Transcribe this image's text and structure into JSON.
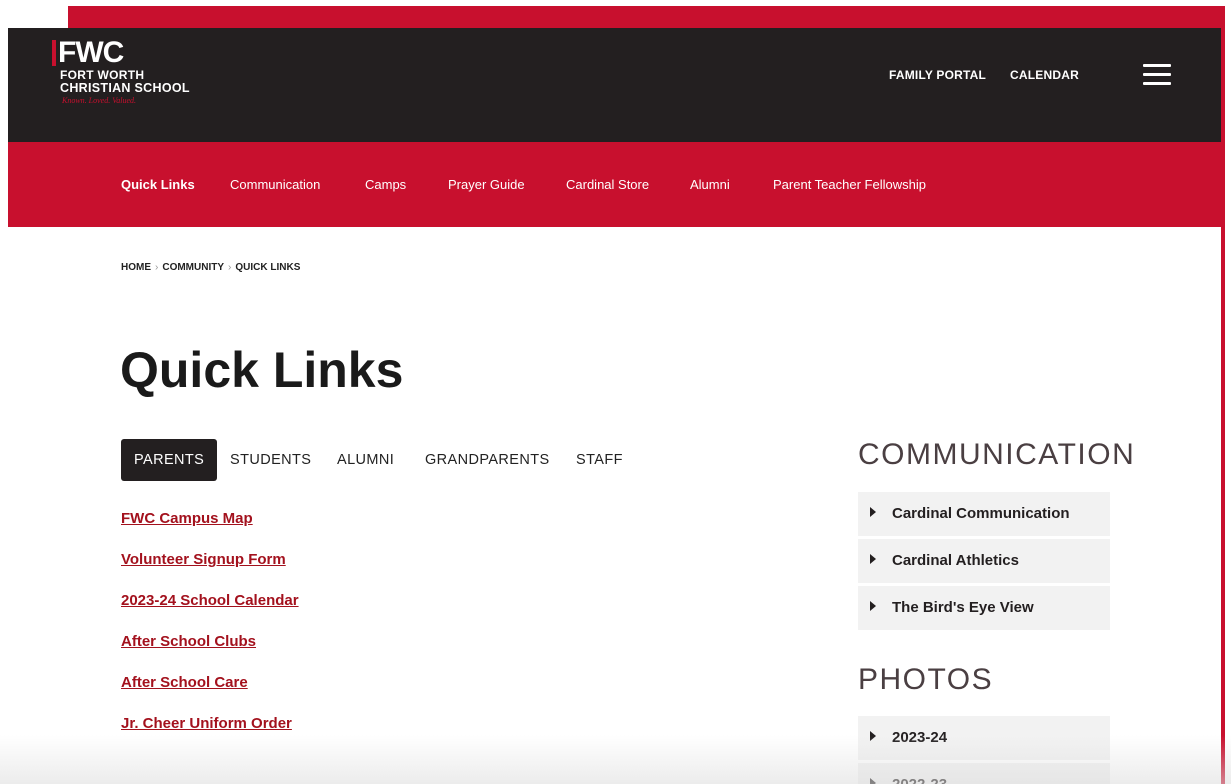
{
  "header": {
    "logo_mark": "FWC",
    "logo_line1": "FORT WORTH",
    "logo_line2": "CHRISTIAN SCHOOL",
    "logo_tagline": "Known. Loved. Valued.",
    "family_portal": "FAMILY PORTAL",
    "calendar": "CALENDAR",
    "menu_icon": "hamburger-icon"
  },
  "subnav": {
    "items": [
      "Quick Links",
      "Communication",
      "Camps",
      "Prayer Guide",
      "Cardinal Store",
      "Alumni",
      "Parent Teacher Fellowship"
    ],
    "active": "Quick Links"
  },
  "breadcrumb": {
    "items": [
      "HOME",
      "COMMUNITY",
      "QUICK LINKS"
    ],
    "separator": "›"
  },
  "page_title": "Quick Links",
  "tabs": {
    "items": [
      "PARENTS",
      "STUDENTS",
      "ALUMNI",
      "GRANDPARENTS",
      "STAFF"
    ],
    "active": "PARENTS"
  },
  "quick_links": [
    "FWC Campus Map",
    "Volunteer Signup Form",
    "2023-24 School Calendar",
    "After School Clubs",
    "After School Care",
    "Jr. Cheer Uniform Order"
  ],
  "sidebar": {
    "communication_heading": "COMMUNICATION",
    "communication_items": [
      "Cardinal Communication",
      "Cardinal Athletics",
      "The Bird's Eye View"
    ],
    "photos_heading": "PHOTOS",
    "photos_items": [
      "2023-24",
      "2022-23"
    ]
  },
  "colors": {
    "brand_red": "#c8102e",
    "header_dark": "#231f20",
    "link_red": "#a3111d"
  }
}
